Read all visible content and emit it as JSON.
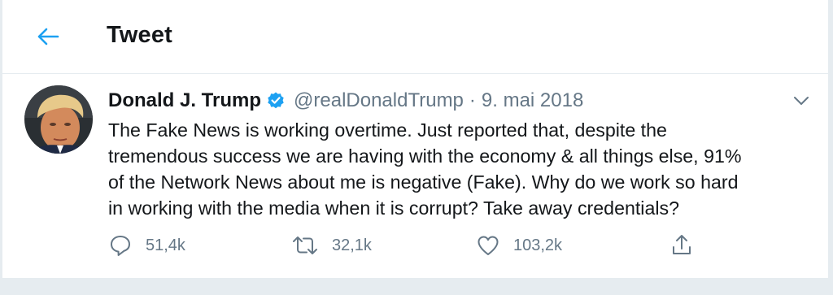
{
  "header": {
    "title": "Tweet",
    "back_icon": "arrow-left-icon",
    "accent": "#1da1f2"
  },
  "tweet": {
    "author_name": "Donald J. Trump",
    "verified_icon": "verified-badge-icon",
    "handle": "@realDonaldTrump",
    "separator": "·",
    "date": "9. mai 2018",
    "text_lines": [
      "The Fake News is working overtime. Just reported that, despite the",
      "tremendous success we are having with the economy & all things else, 91%",
      "of the Network News about me is negative (Fake). Why do we work so hard",
      "in working with the media when it is corrupt? Take away credentials?"
    ],
    "actions": {
      "reply_count": "51,4k",
      "retweet_count": "32,1k",
      "like_count": "103,2k"
    }
  },
  "colors": {
    "text": "#14171a",
    "secondary": "#657786",
    "border": "#e6ecf0",
    "verified": "#1da1f2"
  }
}
